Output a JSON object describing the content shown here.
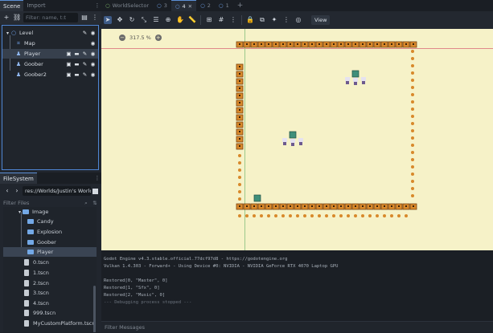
{
  "scene_dock": {
    "tabs": [
      "Scene",
      "Import"
    ],
    "filter_placeholder": "Filter: name, t:t",
    "nodes": [
      {
        "label": "Level",
        "icon": "node2d-icon"
      },
      {
        "label": "Map",
        "icon": "tilemap-icon"
      },
      {
        "label": "Player",
        "icon": "character-icon"
      },
      {
        "label": "Goober",
        "icon": "character-icon"
      },
      {
        "label": "Goober2",
        "icon": "character-icon"
      }
    ]
  },
  "filesystem": {
    "tab": "FileSystem",
    "path": "res://Worlds/Justin's World/",
    "filter_placeholder": "Filter Files",
    "items": [
      {
        "label": "Image",
        "type": "folder"
      },
      {
        "label": "Candy",
        "type": "folder"
      },
      {
        "label": "Explosion",
        "type": "folder"
      },
      {
        "label": "Goober",
        "type": "folder"
      },
      {
        "label": "Player",
        "type": "folder"
      },
      {
        "label": "0.tscn",
        "type": "file"
      },
      {
        "label": "1.tscn",
        "type": "file"
      },
      {
        "label": "2.tscn",
        "type": "file"
      },
      {
        "label": "3.tscn",
        "type": "file"
      },
      {
        "label": "4.tscn",
        "type": "file"
      },
      {
        "label": "999.tscn",
        "type": "file"
      },
      {
        "label": "MyCustomPlatform.tscn",
        "type": "file"
      }
    ]
  },
  "scene_tabs": [
    {
      "label": "WorldSelector"
    },
    {
      "label": "3"
    },
    {
      "label": "4"
    },
    {
      "label": "2"
    },
    {
      "label": "1"
    }
  ],
  "toolbar": {
    "view_label": "View"
  },
  "viewport": {
    "zoom": "317.5 %"
  },
  "output": {
    "lines": [
      "Godot Engine v4.3.stable.official.77dcf97d8 - https://godotengine.org",
      "Vulkan 1.4.303 - Forward+ - Using Device #0: NVIDIA - NVIDIA GeForce RTX 4070 Laptop GPU",
      "",
      "Restored[0, \"Master\", 0]",
      "Restored[1, \"Sfx\", 0]",
      "Restored[2, \"Music\", 0]",
      "--- Debugging process stopped ---"
    ],
    "filter_placeholder": "Filter Messages"
  },
  "colors": {
    "accent": "#4f86d4",
    "viewport_bg": "#f6f2c8",
    "chest_orange": "#d8892b"
  }
}
